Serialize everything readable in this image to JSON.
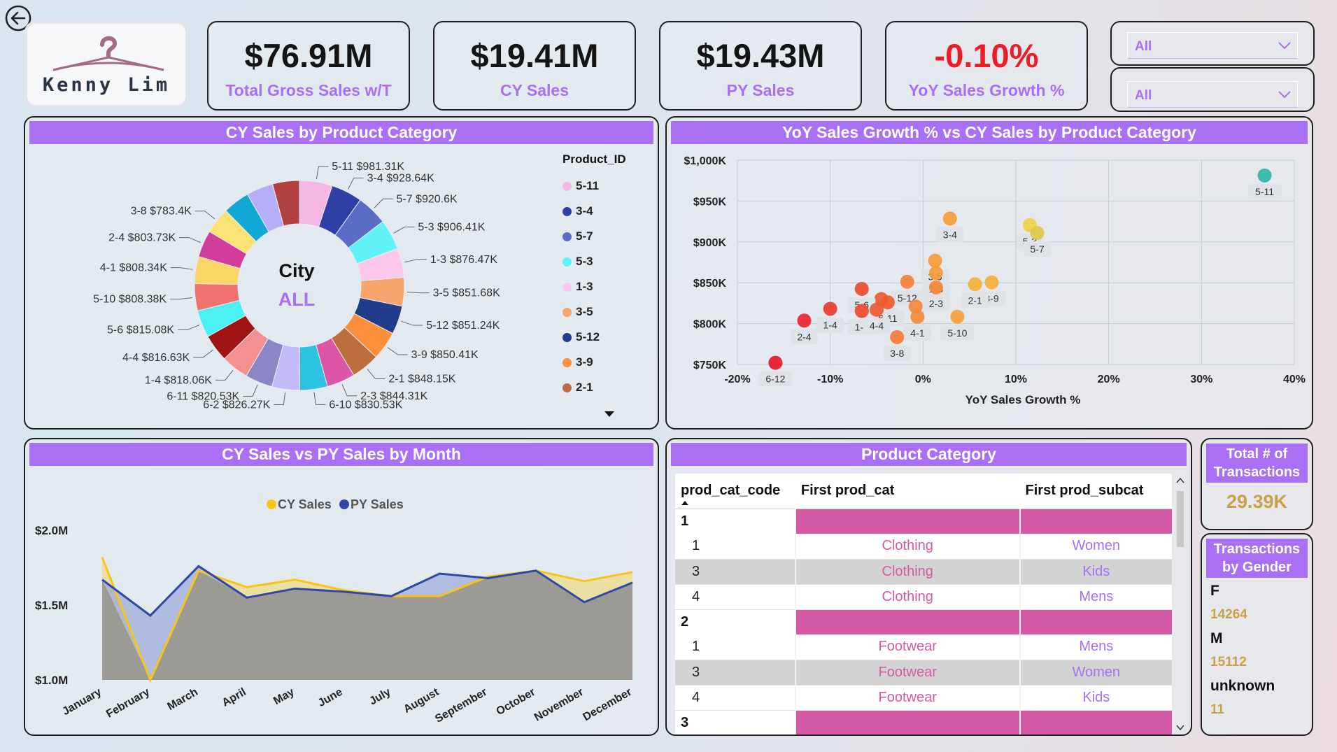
{
  "brand": {
    "name": "Kenny Lim"
  },
  "kpis": [
    {
      "value": "$76.91M",
      "label": "Total Gross Sales w/T"
    },
    {
      "value": "$19.41M",
      "label": "CY Sales"
    },
    {
      "value": "$19.43M",
      "label": "PY Sales"
    },
    {
      "value": "-0.10%",
      "label": "YoY Sales Growth %"
    }
  ],
  "filters": [
    {
      "value": "All"
    },
    {
      "value": "All"
    }
  ],
  "colors": {
    "accent": "#a96ff5",
    "negative": "#ee1c25",
    "pink": "#d55aa6",
    "gold": "#c8a24a",
    "cy": "#f5c518",
    "py": "#2f48a8"
  },
  "donut": {
    "title": "CY Sales by Product Category",
    "center_title": "City",
    "center_value": "ALL",
    "legend_title": "Product_ID"
  },
  "scatter": {
    "title": "YoY Sales Growth % vs CY Sales by Product Category",
    "xlabel": "YoY Sales Growth %"
  },
  "area": {
    "title": "CY Sales vs PY Sales by Month",
    "legend": [
      "CY Sales",
      "PY Sales"
    ]
  },
  "table": {
    "title": "Product Category",
    "headers": [
      "prod_cat_code",
      "First prod_cat",
      "First prod_subcat"
    ],
    "groups": [
      {
        "code": "1",
        "rows": [
          [
            "1",
            "Clothing",
            "Women"
          ],
          [
            "3",
            "Clothing",
            "Kids"
          ],
          [
            "4",
            "Clothing",
            "Mens"
          ]
        ]
      },
      {
        "code": "2",
        "rows": [
          [
            "1",
            "Footwear",
            "Mens"
          ],
          [
            "3",
            "Footwear",
            "Women"
          ],
          [
            "4",
            "Footwear",
            "Kids"
          ]
        ]
      },
      {
        "code": "3",
        "rows": []
      }
    ]
  },
  "transactions": {
    "title": "Total # of Transactions",
    "value": "29.39K"
  },
  "gender": {
    "title": "Transactions by Gender",
    "items": [
      {
        "label": "F",
        "value": "14264"
      },
      {
        "label": "M",
        "value": "15112"
      },
      {
        "label": "unknown",
        "value": "11"
      }
    ]
  },
  "chart_data": [
    {
      "type": "pie",
      "title": "CY Sales by Product Category",
      "slices": [
        {
          "id": "5-11",
          "label": "5-11 $981.31K",
          "value": 981.31,
          "color": "#f7b7e4"
        },
        {
          "id": "3-4",
          "label": "3-4 $928.64K",
          "value": 928.64,
          "color": "#2e3fa5"
        },
        {
          "id": "5-7",
          "label": "5-7 $920.6K",
          "value": 920.6,
          "color": "#5b6cc7"
        },
        {
          "id": "5-3",
          "label": "5-3 $906.41K",
          "value": 906.41,
          "color": "#5ff2f7"
        },
        {
          "id": "1-3",
          "label": "1-3 $876.47K",
          "value": 876.47,
          "color": "#fcc9ec"
        },
        {
          "id": "3-5",
          "label": "3-5 $851.68K",
          "value": 851.68,
          "color": "#f8a56d"
        },
        {
          "id": "5-12",
          "label": "5-12 $851.24K",
          "value": 851.24,
          "color": "#223c8c"
        },
        {
          "id": "3-9",
          "label": "3-9 $850.41K",
          "value": 850.41,
          "color": "#fb8f3b"
        },
        {
          "id": "2-1",
          "label": "2-1 $848.15K",
          "value": 848.15,
          "color": "#bd6e3c"
        },
        {
          "id": "2-3",
          "label": "2-3 $844.31K",
          "value": 844.31,
          "color": "#dc56a8"
        },
        {
          "id": "6-10",
          "label": "6-10 $830.53K",
          "value": 830.53,
          "color": "#2cc3e2"
        },
        {
          "id": "6-2",
          "label": "6-2 $826.27K",
          "value": 826.27,
          "color": "#c3baf9"
        },
        {
          "id": "6-11",
          "label": "6-11 $820.53K",
          "value": 820.53,
          "color": "#8b87c7"
        },
        {
          "id": "1-4",
          "label": "1-4 $818.06K",
          "value": 818.06,
          "color": "#f48f92"
        },
        {
          "id": "4-4",
          "label": "4-4 $816.63K",
          "value": 816.63,
          "color": "#a11414"
        },
        {
          "id": "5-6",
          "label": "5-6 $815.08K",
          "value": 815.08,
          "color": "#4af0f2"
        },
        {
          "id": "5-10",
          "label": "5-10 $808.38K",
          "value": 808.38,
          "color": "#f07370"
        },
        {
          "id": "4-1",
          "label": "4-1 $808.34K",
          "value": 808.34,
          "color": "#fbd566"
        },
        {
          "id": "2-4",
          "label": "2-4 $803.73K",
          "value": 803.73,
          "color": "#d23c9b"
        },
        {
          "id": "3-8",
          "label": "3-8 $783.4K",
          "value": 783.4,
          "color": "#fbe274"
        },
        {
          "id": "s21",
          "label": "",
          "value": 800,
          "color": "#11a8d6"
        },
        {
          "id": "s22",
          "label": "",
          "value": 800,
          "color": "#b7aef8"
        },
        {
          "id": "s23",
          "label": "",
          "value": 800,
          "color": "#b24040"
        }
      ],
      "legend": [
        "5-11",
        "3-4",
        "5-7",
        "5-3",
        "1-3",
        "3-5",
        "5-12",
        "3-9",
        "2-1"
      ]
    },
    {
      "type": "scatter",
      "title": "YoY Sales Growth % vs CY Sales by Product Category",
      "xlabel": "YoY Sales Growth %",
      "ylabel": "",
      "xlim": [
        -20,
        40
      ],
      "ylim": [
        750,
        1000
      ],
      "xticks": [
        "-20%",
        "-10%",
        "0%",
        "10%",
        "20%",
        "30%",
        "40%"
      ],
      "yticks": [
        "$750K",
        "$800K",
        "$850K",
        "$900K",
        "$950K",
        "$1,000K"
      ],
      "points": [
        {
          "label": "5-11",
          "x": 36.8,
          "y": 981.3,
          "color": "#2eb8a5"
        },
        {
          "label": "5-3",
          "x": 11.5,
          "y": 920.5,
          "color": "#f0d046"
        },
        {
          "label": "5-7",
          "x": 12.3,
          "y": 911.0,
          "color": "#dcc84a"
        },
        {
          "label": "3-4",
          "x": 2.9,
          "y": 928.6,
          "color": "#f59a3a"
        },
        {
          "label": "3-5",
          "x": 1.3,
          "y": 877.0,
          "color": "#f59a3a"
        },
        {
          "label": "1-3",
          "x": 1.4,
          "y": 862.0,
          "color": "#f59a3a"
        },
        {
          "label": "3-9",
          "x": 7.4,
          "y": 850.4,
          "color": "#f5b03a"
        },
        {
          "label": "2-1",
          "x": 5.6,
          "y": 848.1,
          "color": "#f5b03a"
        },
        {
          "label": "2-3",
          "x": 1.4,
          "y": 844.3,
          "color": "#f5883a"
        },
        {
          "label": "5-12",
          "x": -1.7,
          "y": 851.2,
          "color": "#f5803a"
        },
        {
          "label": "3-10",
          "x": -4.5,
          "y": 830.0,
          "color": "#ee5a2e"
        },
        {
          "label": "5-6",
          "x": -6.6,
          "y": 842.5,
          "color": "#ee4a2e"
        },
        {
          "label": "1-1",
          "x": -6.6,
          "y": 815.5,
          "color": "#ee4a2e"
        },
        {
          "label": "6-11",
          "x": -3.8,
          "y": 826.0,
          "color": "#ee5a2e"
        },
        {
          "label": "4-4",
          "x": -5.0,
          "y": 817.0,
          "color": "#ee5a2e"
        },
        {
          "label": "4-1",
          "x": -0.6,
          "y": 808.3,
          "color": "#f5883a"
        },
        {
          "label": "5-10",
          "x": 3.7,
          "y": 808.4,
          "color": "#f5a03a"
        },
        {
          "label": "3-8",
          "x": -2.8,
          "y": 783.4,
          "color": "#f57a3a"
        },
        {
          "label": "1-4",
          "x": -10.0,
          "y": 818.1,
          "color": "#ee3a2e"
        },
        {
          "label": "2-4",
          "x": -12.8,
          "y": 803.7,
          "color": "#e8262e"
        },
        {
          "label": "6-12",
          "x": -15.9,
          "y": 752.0,
          "color": "#e8162e"
        },
        {
          "label": "",
          "x": -0.8,
          "y": 821.0,
          "color": "#f5883a"
        }
      ]
    },
    {
      "type": "area",
      "title": "CY Sales vs PY Sales by Month",
      "categories": [
        "January",
        "February",
        "March",
        "April",
        "May",
        "June",
        "July",
        "August",
        "September",
        "October",
        "November",
        "December"
      ],
      "ylim": [
        1.0,
        2.0
      ],
      "yticks": [
        "$1.0M",
        "$1.5M",
        "$2.0M"
      ],
      "series": [
        {
          "name": "CY Sales",
          "color": "#f5c518",
          "values": [
            1.82,
            1.0,
            1.73,
            1.62,
            1.67,
            1.6,
            1.56,
            1.56,
            1.69,
            1.73,
            1.66,
            1.72
          ]
        },
        {
          "name": "PY Sales",
          "color": "#2f48a8",
          "values": [
            1.67,
            1.43,
            1.76,
            1.55,
            1.61,
            1.59,
            1.56,
            1.71,
            1.68,
            1.73,
            1.52,
            1.65
          ]
        }
      ]
    }
  ]
}
